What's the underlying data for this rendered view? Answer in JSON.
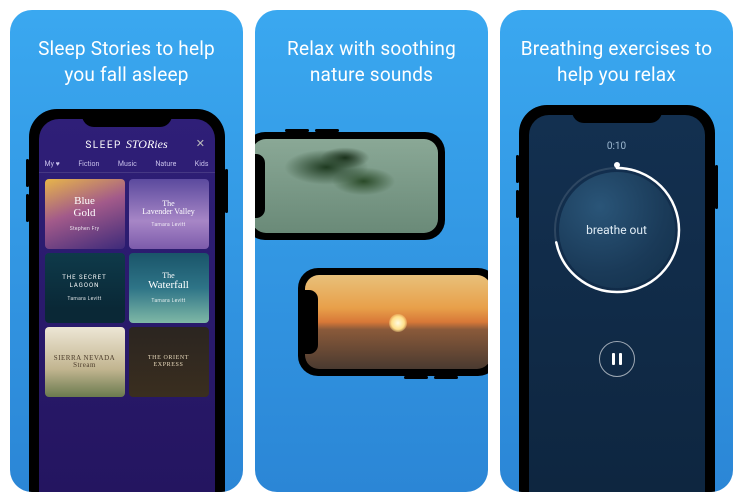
{
  "panels": [
    {
      "headline": "Sleep Stories to help you fall asleep"
    },
    {
      "headline": "Relax with soothing nature sounds"
    },
    {
      "headline": "Breathing exercises to help you relax"
    }
  ],
  "sleep_stories": {
    "title_part1": "SLEEP ",
    "title_part2": "STORies",
    "close": "✕",
    "tabs": [
      "My ♥",
      "Fiction",
      "Music",
      "Nature",
      "Kids"
    ],
    "items": [
      {
        "line1": "Blue",
        "line2": "Gold",
        "author": "Stephen Fry"
      },
      {
        "line1": "The",
        "line2": "Lavender Valley",
        "author": "Tamara Levitt"
      },
      {
        "title": "THE SECRET LAGOON",
        "author": "Tamara Levitt"
      },
      {
        "line1": "The",
        "line2": "Waterfall",
        "author": "Tamara Levitt"
      },
      {
        "title": "SIERRA NEVADA Stream",
        "author": ""
      },
      {
        "title": "THE ORIENT EXPRESS",
        "author": ""
      }
    ]
  },
  "breathe": {
    "timer": "0:10",
    "label": "breathe out"
  }
}
